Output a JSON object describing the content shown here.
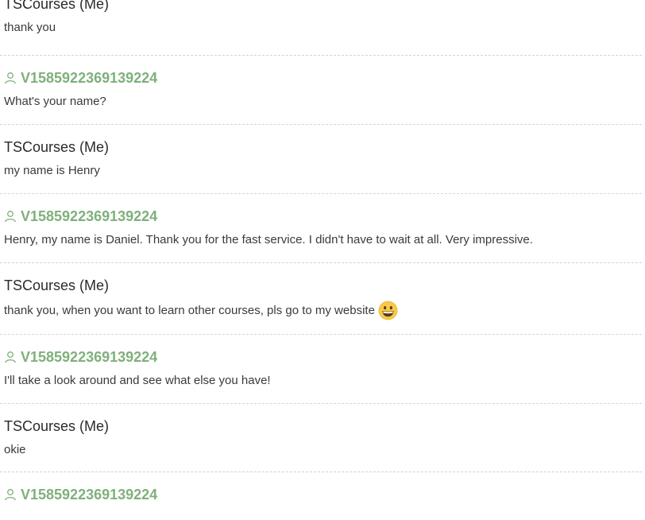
{
  "messages": [
    {
      "sender": "TSCourses (Me)",
      "type": "me",
      "text": "thank you"
    },
    {
      "sender": "V1585922369139224",
      "type": "visitor",
      "text": "What's your name?"
    },
    {
      "sender": "TSCourses (Me)",
      "type": "me",
      "text": "my name is Henry"
    },
    {
      "sender": "V1585922369139224",
      "type": "visitor",
      "text": "Henry, my name is Daniel. Thank you for the fast service. I didn't have to wait at all. Very impressive."
    },
    {
      "sender": "TSCourses (Me)",
      "type": "me",
      "text": "thank you, when you want to learn other courses, pls go to my website",
      "emoji": "grinning-face"
    },
    {
      "sender": "V1585922369139224",
      "type": "visitor",
      "text": "I'll take a look around and see what else you have!"
    },
    {
      "sender": "TSCourses (Me)",
      "type": "me",
      "text": "okie"
    },
    {
      "sender": "V1585922369139224",
      "type": "visitor",
      "text": ""
    }
  ],
  "colors": {
    "visitor": "#7fb07a",
    "me": "#2a2a2a",
    "divider": "#d3d3d3"
  }
}
